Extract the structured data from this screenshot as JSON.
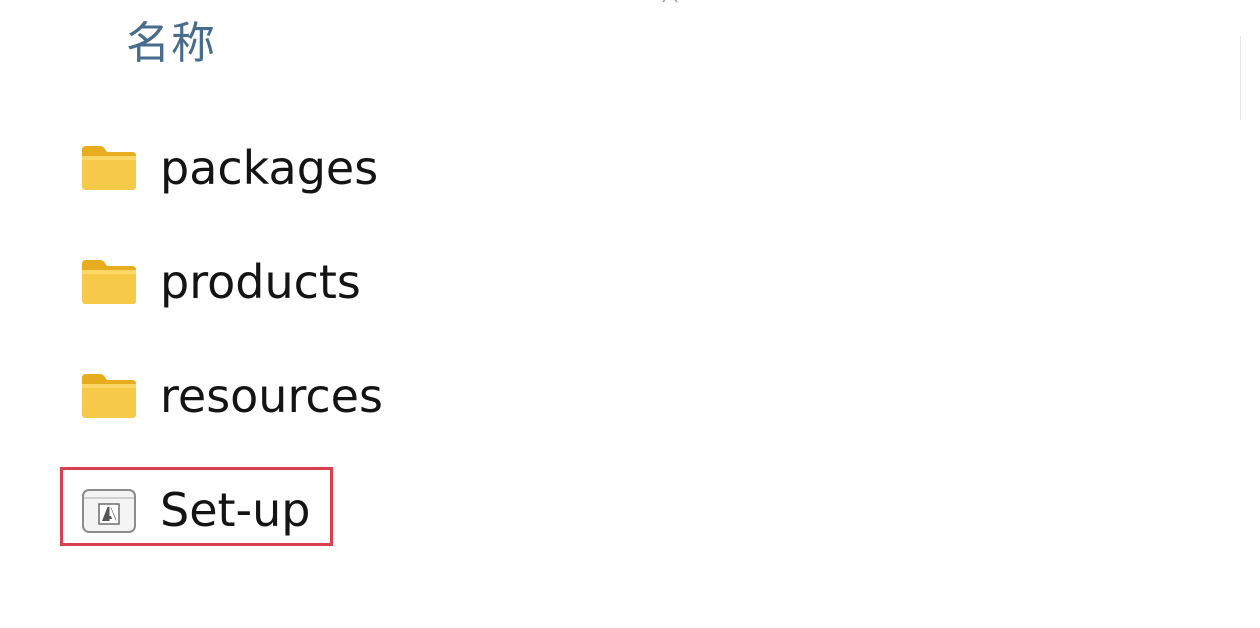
{
  "column_header": {
    "name_label": "名称"
  },
  "files": [
    {
      "name": "packages",
      "icon": "folder-icon"
    },
    {
      "name": "products",
      "icon": "folder-icon"
    },
    {
      "name": "resources",
      "icon": "folder-icon"
    },
    {
      "name": "Set-up",
      "icon": "adobe-installer-icon"
    }
  ],
  "highlight": {
    "target": "Set-up",
    "color": "#d9404e"
  },
  "colors": {
    "header_text": "#4a6c8c",
    "folder_yellow": "#f7c948",
    "folder_yellow_dark": "#e8ad1f",
    "item_text": "#141414"
  }
}
